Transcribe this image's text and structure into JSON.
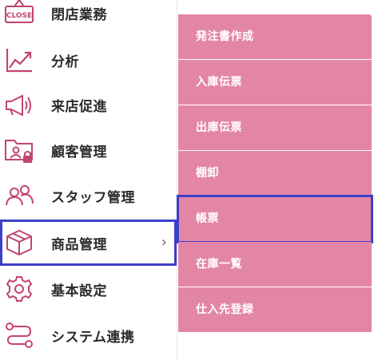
{
  "left_menu": {
    "items": [
      {
        "label": "閉店業務",
        "icon": "close-sign-icon"
      },
      {
        "label": "分析",
        "icon": "line-chart-icon"
      },
      {
        "label": "来店促進",
        "icon": "megaphone-icon"
      },
      {
        "label": "顧客管理",
        "icon": "customer-folder-lock-icon"
      },
      {
        "label": "スタッフ管理",
        "icon": "staff-people-icon"
      },
      {
        "label": "商品管理",
        "icon": "product-box-icon",
        "selected": true
      },
      {
        "label": "基本設定",
        "icon": "gear-icon"
      },
      {
        "label": "システム連携",
        "icon": "connection-icon"
      }
    ],
    "chevron": "›",
    "close_sign_text": "CLOSE"
  },
  "submenu": {
    "items": [
      {
        "label": "発注書作成"
      },
      {
        "label": "入庫伝票"
      },
      {
        "label": "出庫伝票"
      },
      {
        "label": "棚卸"
      },
      {
        "label": "帳票",
        "selected": true
      },
      {
        "label": "在庫一覧"
      },
      {
        "label": "仕入先登録"
      }
    ]
  },
  "colors": {
    "accent": "#c2446f",
    "submenu_bg": "#e386a6",
    "highlight": "#3c3fc8"
  }
}
